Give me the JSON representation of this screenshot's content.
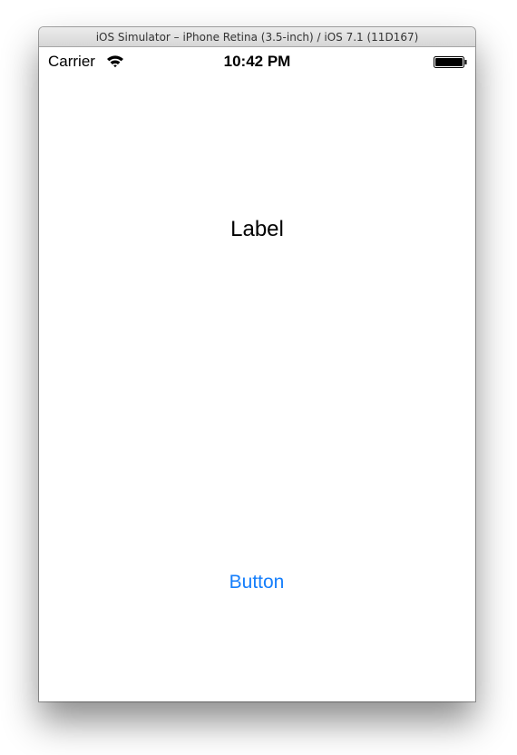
{
  "window": {
    "title": "iOS Simulator – iPhone Retina (3.5-inch) / iOS 7.1 (11D167)"
  },
  "status_bar": {
    "carrier": "Carrier",
    "time": "10:42 PM",
    "wifi_icon": "wifi-icon",
    "battery_icon": "battery-icon"
  },
  "content": {
    "label": "Label",
    "button": "Button"
  },
  "colors": {
    "button_tint": "#157efb",
    "text": "#000000",
    "background": "#ffffff"
  }
}
